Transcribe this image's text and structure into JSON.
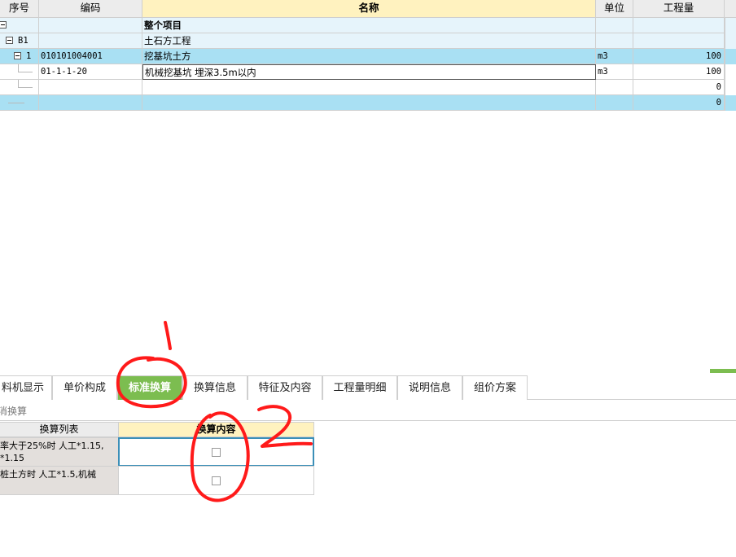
{
  "table": {
    "headers": {
      "seq": "序号",
      "code": "编码",
      "name": "名称",
      "unit": "单位",
      "qty": "工程量"
    },
    "rows": [
      {
        "seq": "",
        "code": "",
        "name": "整个项目",
        "unit": "",
        "qty": ""
      },
      {
        "seq": "B1",
        "code": "",
        "name": "土石方工程",
        "unit": "",
        "qty": ""
      },
      {
        "seq": "1",
        "code": "010101004001",
        "name": "挖基坑土方",
        "unit": "m3",
        "qty": "100"
      },
      {
        "seq": "",
        "code": "01-1-1-20",
        "name": "机械挖基坑 埋深3.5m以内",
        "unit": "m3",
        "qty": "100"
      },
      {
        "seq": "",
        "code": "",
        "name": "",
        "unit": "",
        "qty": "0"
      },
      {
        "seq": "",
        "code": "",
        "name": "",
        "unit": "",
        "qty": "0"
      }
    ]
  },
  "tabs": [
    "料机显示",
    "单价构成",
    "标准换算",
    "换算信息",
    "特征及内容",
    "工程量明细",
    "说明信息",
    "组价方案"
  ],
  "active_tab": "标准换算",
  "sub_toolbar": {
    "label": "消换算"
  },
  "conversion": {
    "headers": {
      "list": "换算列表",
      "content": "换算内容"
    },
    "rows": [
      {
        "line1": "率大于25%时 人工*1.15,",
        "line2": "*1.15"
      },
      {
        "line1": "桩土方时 人工*1.5,机械",
        "line2": ""
      }
    ]
  },
  "annotations": {
    "one": "1",
    "two": "2"
  },
  "colors": {
    "selected_row": "#a9e0f3",
    "group_row": "#e6f4fb",
    "active_tab": "#7cbd50",
    "header_name": "#fff2bf",
    "annotation": "#ff1a1a"
  }
}
